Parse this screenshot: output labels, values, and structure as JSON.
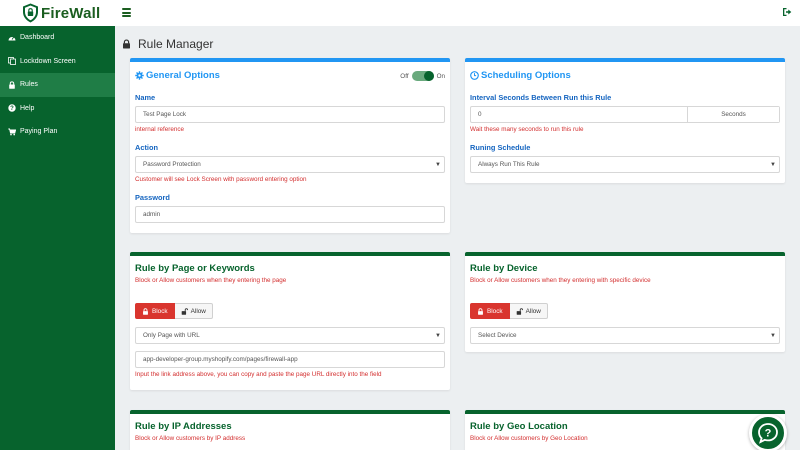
{
  "brand": {
    "name": "FireWall",
    "logo_icon": "shield-lock-icon",
    "color": "#07632d"
  },
  "topbar": {
    "menu_icon": "hamburger-icon",
    "logout_icon": "logout-icon"
  },
  "sidebar": {
    "items": [
      {
        "label": "Dashboard",
        "icon": "dashboard-icon"
      },
      {
        "label": "Lockdown Screen",
        "icon": "copy-icon"
      },
      {
        "label": "Rules",
        "icon": "lock-icon",
        "active": true
      },
      {
        "label": "Help",
        "icon": "question-icon"
      },
      {
        "label": "Paying Plan",
        "icon": "cart-icon"
      }
    ]
  },
  "page": {
    "title": "Rule Manager",
    "icon": "lock-icon"
  },
  "general": {
    "title": "General Options",
    "toggle_off": "Off",
    "toggle_on": "On",
    "toggle_state": "on",
    "name_label": "Name",
    "name_value": "Test Page Lock",
    "name_help": "internal reference",
    "action_label": "Action",
    "action_value": "Password Protection",
    "action_help": "Customer will see Lock Screen with password entering option",
    "password_label": "Password",
    "password_value": "admin"
  },
  "scheduling": {
    "title": "Scheduling Options",
    "interval_label": "Interval Seconds Between Run this Rule",
    "interval_value": "0",
    "interval_addon": "Seconds",
    "interval_help": "Wait these many seconds to run this rule",
    "schedule_label": "Runing Schedule",
    "schedule_value": "Always Run This Rule"
  },
  "page_rule": {
    "title": "Rule by Page or Keywords",
    "subtitle": "Block or Allow customers when they entering the page",
    "block_label": "Block",
    "allow_label": "Allow",
    "match_value": "Only Page with URL",
    "url_value": "app-developer-group.myshopify.com/pages/firewall-app",
    "url_help": "Input the link address above, you can copy and paste the page URL directly into the field"
  },
  "device_rule": {
    "title": "Rule by Device",
    "subtitle": "Block or Allow customers when they entering with specific device",
    "block_label": "Block",
    "allow_label": "Allow",
    "device_value": "Select Device"
  },
  "ip_rule": {
    "title": "Rule by IP Addresses",
    "subtitle": "Block or Allow customers by IP address"
  },
  "geo_rule": {
    "title": "Rule by Geo Location",
    "subtitle": "Block or Allow customers by Geo Location"
  },
  "chat": {
    "icon": "help-chat-icon"
  }
}
